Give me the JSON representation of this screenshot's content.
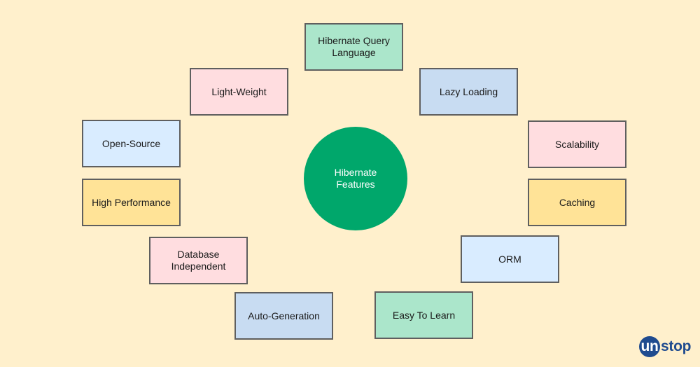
{
  "diagram": {
    "title": "Hibernate Features",
    "center_label": "Hibernate\nFeatures",
    "features": [
      {
        "id": "hql",
        "label": "Hibernate Query\nLanguage",
        "color": "#abe6cb"
      },
      {
        "id": "light-weight",
        "label": "Light-Weight",
        "color": "#ffdde0"
      },
      {
        "id": "lazy-loading",
        "label": "Lazy Loading",
        "color": "#c8dcf2"
      },
      {
        "id": "open-source",
        "label": "Open-Source",
        "color": "#d9ecff"
      },
      {
        "id": "scalability",
        "label": "Scalability",
        "color": "#ffdde0"
      },
      {
        "id": "high-performance",
        "label": "High Performance",
        "color": "#ffe397"
      },
      {
        "id": "caching",
        "label": "Caching",
        "color": "#ffe397"
      },
      {
        "id": "database-independent",
        "label": "Database\nIndependent",
        "color": "#ffdde0"
      },
      {
        "id": "orm",
        "label": "ORM",
        "color": "#d9ecff"
      },
      {
        "id": "auto-generation",
        "label": "Auto-Generation",
        "color": "#c8dcf2"
      },
      {
        "id": "easy-to-learn",
        "label": "Easy To Learn",
        "color": "#abe6cb"
      }
    ],
    "hub_color": "#00a76b",
    "background_color": "#fff0cc"
  },
  "branding": {
    "logo_prefix": "un",
    "logo_suffix": "stop",
    "logo_color": "#1f4b8f"
  }
}
